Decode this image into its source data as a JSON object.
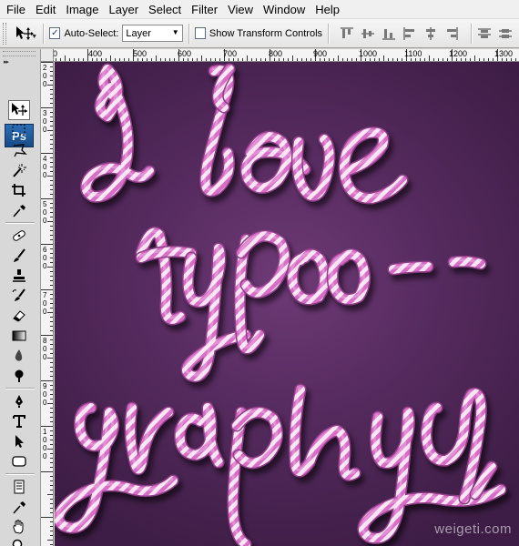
{
  "menu": {
    "items": [
      "File",
      "Edit",
      "Image",
      "Layer",
      "Select",
      "Filter",
      "View",
      "Window",
      "Help"
    ]
  },
  "options_bar": {
    "auto_select_label": "Auto-Select:",
    "auto_select_checked": true,
    "auto_select_target": "Layer",
    "show_transform_label": "Show Transform Controls",
    "show_transform_checked": false
  },
  "toolbox": {
    "logo": "Ps",
    "tools": [
      "move-tool",
      "marquee-tool",
      "lasso-tool",
      "magic-wand-tool",
      "crop-tool",
      "eyedropper-tool",
      "healing-brush-tool",
      "brush-tool",
      "clone-stamp-tool",
      "history-brush-tool",
      "eraser-tool",
      "gradient-tool",
      "blur-tool",
      "dodge-tool",
      "pen-tool",
      "type-tool",
      "path-selection-tool",
      "shape-tool",
      "notes-tool",
      "eyedropper-tool-2",
      "hand-tool",
      "zoom-tool"
    ]
  },
  "ruler": {
    "top_labels": [
      "300",
      "400",
      "500",
      "600",
      "700",
      "800",
      "900",
      "1000",
      "1100",
      "1200",
      "1300"
    ],
    "left_labels": [
      "2",
      "0",
      "0",
      "3",
      "0",
      "0",
      "4",
      "0",
      "0",
      "5",
      "0",
      "0",
      "6",
      "0",
      "0",
      "7",
      "0",
      "0",
      "8",
      "0",
      "0",
      "9",
      "0",
      "0",
      "1",
      "0",
      "0",
      "0"
    ]
  },
  "canvas": {
    "watermark": "weigeti.com",
    "background_color": "#5a2c63",
    "candy_pink": "#e27fd0",
    "candy_white": "#fbeaf7"
  }
}
